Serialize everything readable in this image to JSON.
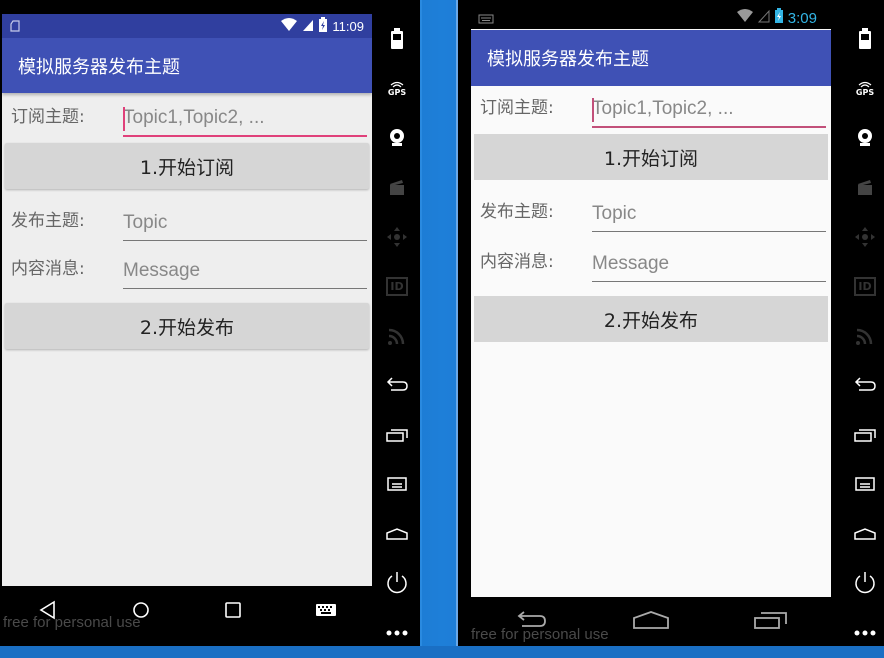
{
  "watermark": "free for personal use",
  "emulators": [
    {
      "status": {
        "time": "11:09",
        "left_icon": "sd-card-icon"
      },
      "app_title": "模拟服务器发布主题",
      "subscribe": {
        "label": "订阅主题:",
        "placeholder": "Topic1,Topic2, ...",
        "button": "1.开始订阅"
      },
      "publish": {
        "topic_label": "发布主题:",
        "topic_placeholder": "Topic",
        "message_label": "内容消息:",
        "message_placeholder": "Message",
        "button": "2.开始发布"
      }
    },
    {
      "status": {
        "time": "3:09",
        "left_icon": "keyboard-icon"
      },
      "app_title": "模拟服务器发布主题",
      "subscribe": {
        "label": "订阅主题:",
        "placeholder": "Topic1,Topic2, ...",
        "button": "1.开始订阅"
      },
      "publish": {
        "topic_label": "发布主题:",
        "topic_placeholder": "Topic",
        "message_label": "内容消息:",
        "message_placeholder": "Message",
        "button": "2.开始发布"
      }
    }
  ],
  "sidebar_tools": [
    "battery",
    "gps",
    "camera",
    "media",
    "dpad",
    "id",
    "rss",
    "back",
    "recent",
    "menu",
    "home",
    "power",
    "more"
  ],
  "sidebar_gps_label": "GPS",
  "sidebar_id_label": "ID",
  "colors": {
    "primary": "#3f51b5",
    "primary_dark": "#303f9f",
    "accent": "#e0407a",
    "button": "#d6d6d6"
  }
}
